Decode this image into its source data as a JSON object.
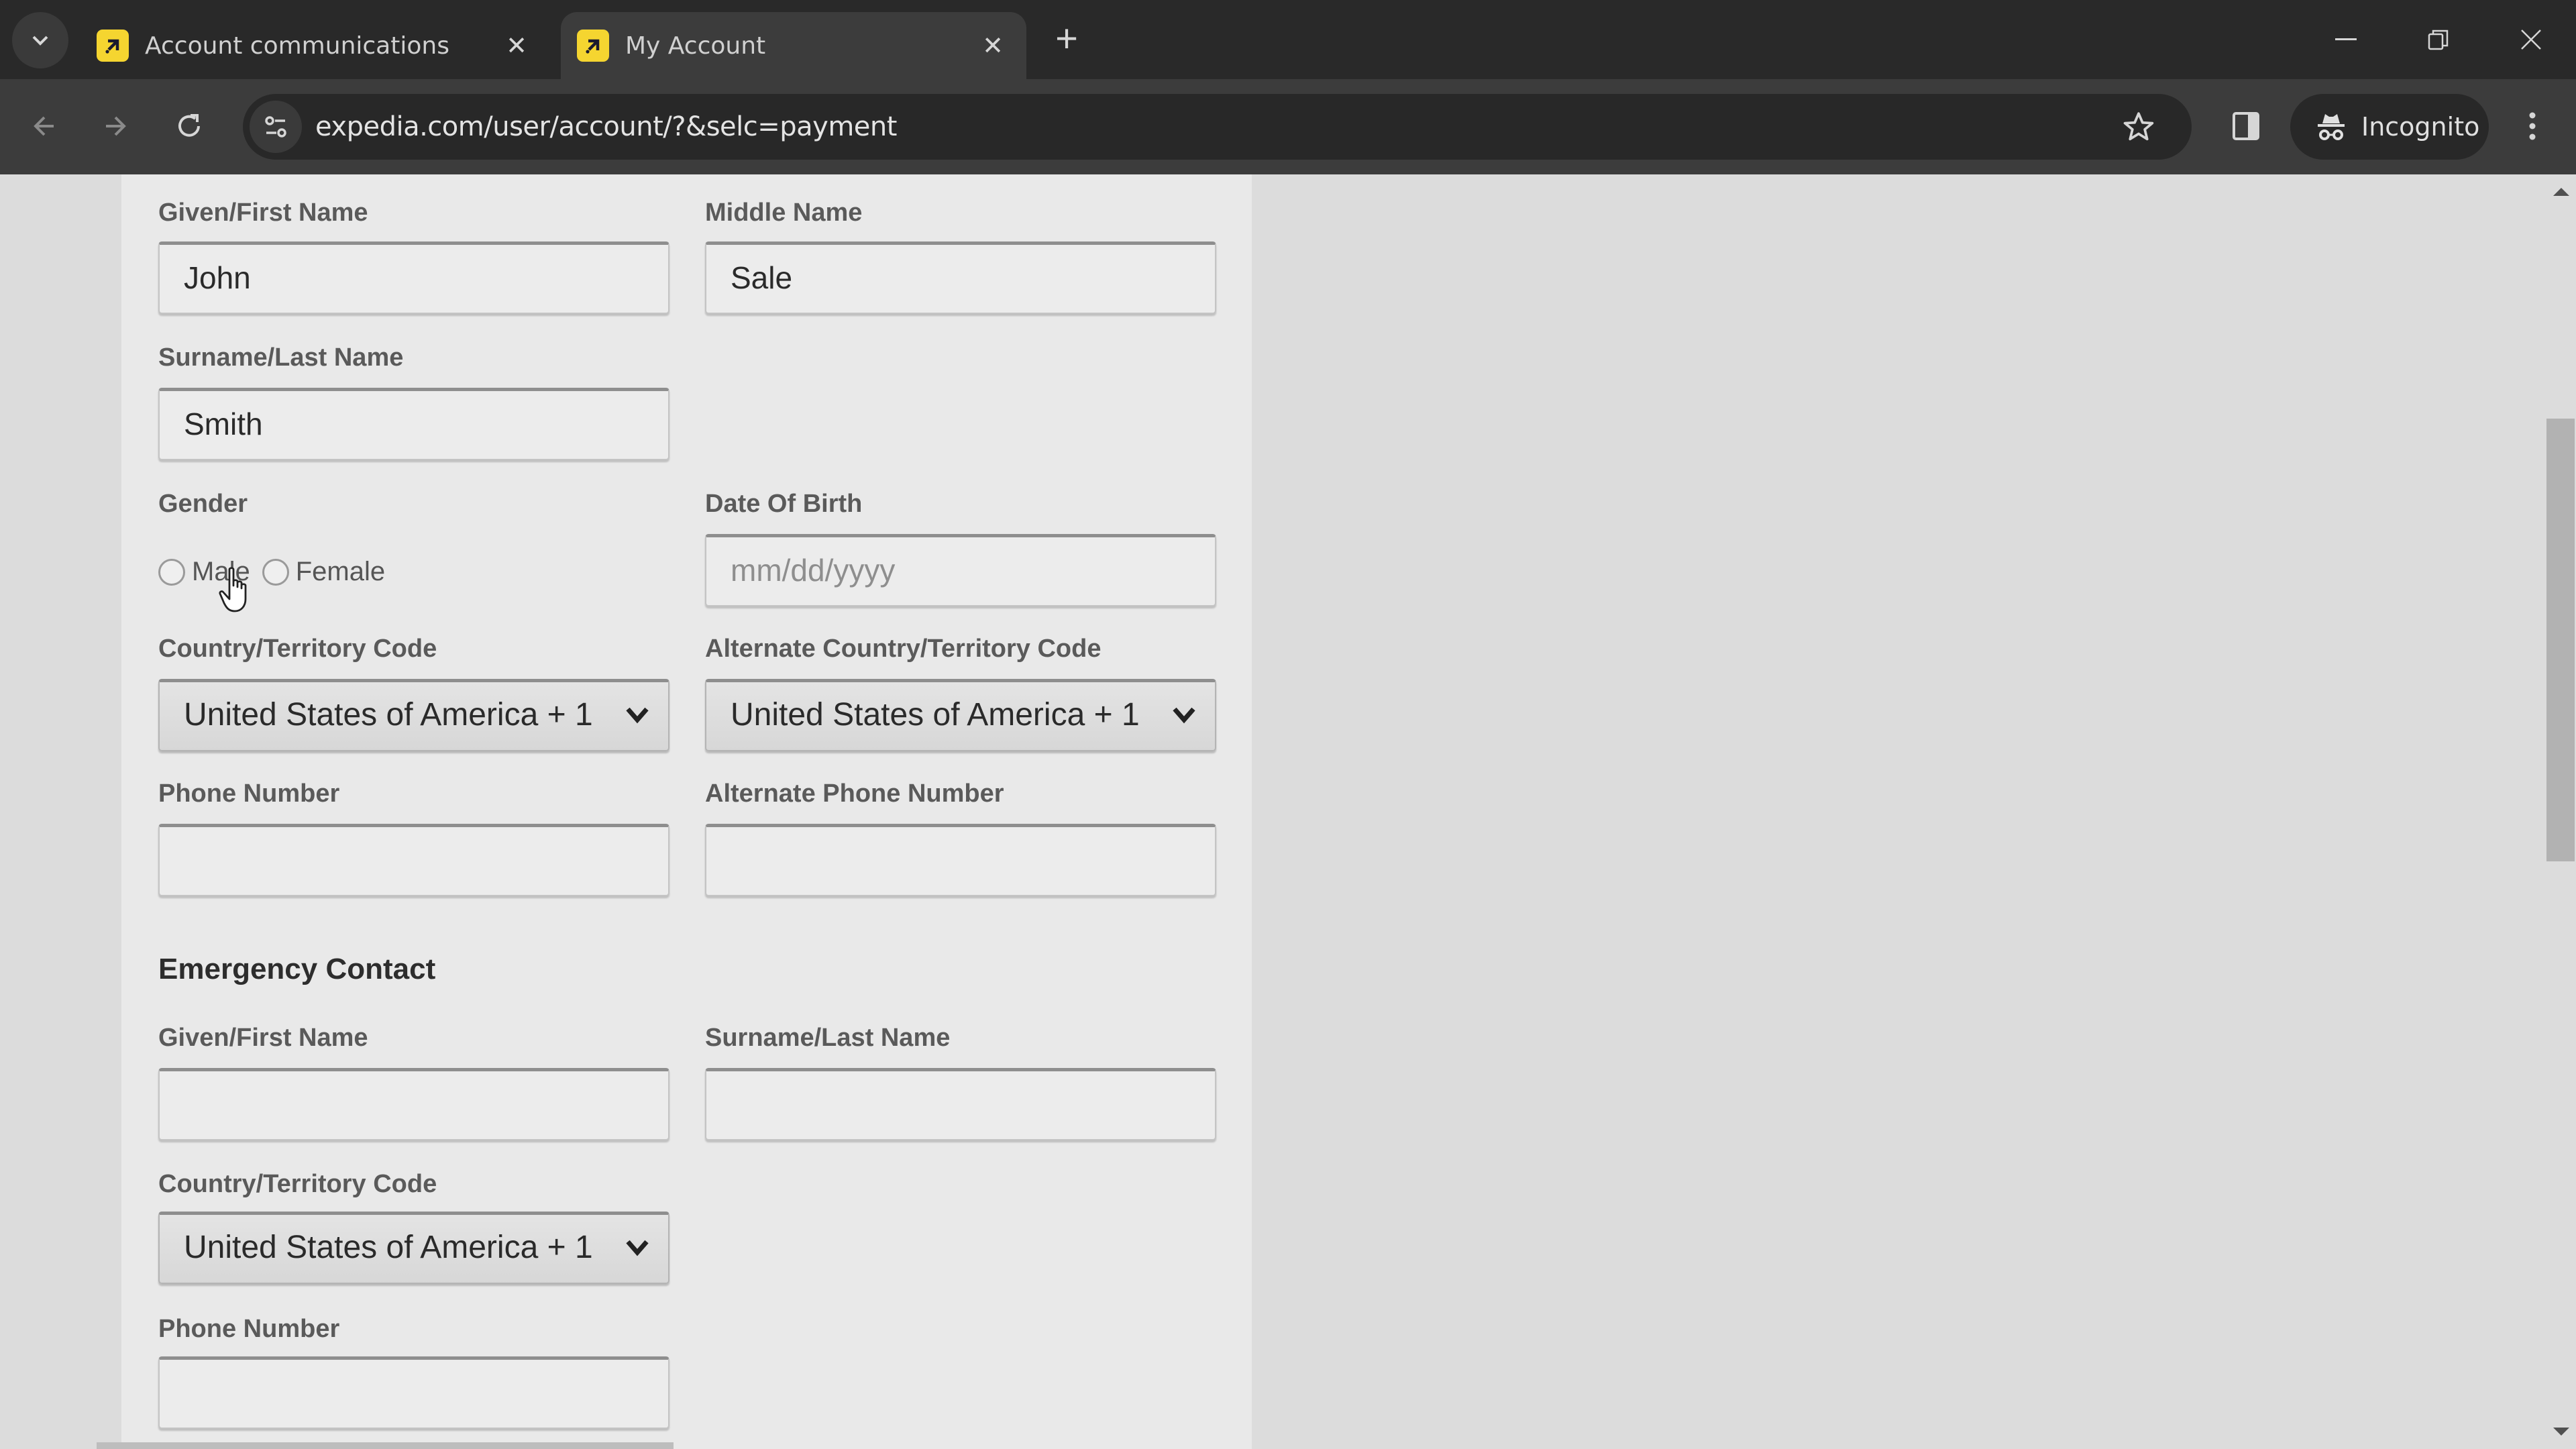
{
  "browser": {
    "tabs": [
      {
        "title": "Account communications",
        "active": false,
        "favicon": "expedia-logo-icon"
      },
      {
        "title": "My Account",
        "active": true,
        "favicon": "expedia-logo-icon"
      }
    ],
    "url": "expedia.com/user/account/?&selc=payment",
    "incognito_label": "Incognito",
    "brand_color": "#f5d530"
  },
  "form": {
    "given_name": {
      "label": "Given/First Name",
      "value": "John"
    },
    "middle_name": {
      "label": "Middle Name",
      "value": "Sale"
    },
    "surname": {
      "label": "Surname/Last Name",
      "value": "Smith"
    },
    "gender": {
      "label": "Gender",
      "options": [
        "Male",
        "Female"
      ],
      "selected": null
    },
    "dob": {
      "label": "Date Of Birth",
      "placeholder": "mm/dd/yyyy",
      "value": ""
    },
    "country_code": {
      "label": "Country/Territory Code",
      "value": "United States of America + 1"
    },
    "alt_country_code": {
      "label": "Alternate Country/Territory Code",
      "value": "United States of America + 1"
    },
    "phone": {
      "label": "Phone Number",
      "value": ""
    },
    "alt_phone": {
      "label": "Alternate Phone Number",
      "value": ""
    }
  },
  "emergency": {
    "heading": "Emergency Contact",
    "given_name": {
      "label": "Given/First Name",
      "value": ""
    },
    "surname": {
      "label": "Surname/Last Name",
      "value": ""
    },
    "country_code": {
      "label": "Country/Territory Code",
      "value": "United States of America + 1"
    },
    "phone": {
      "label": "Phone Number",
      "value": ""
    }
  }
}
